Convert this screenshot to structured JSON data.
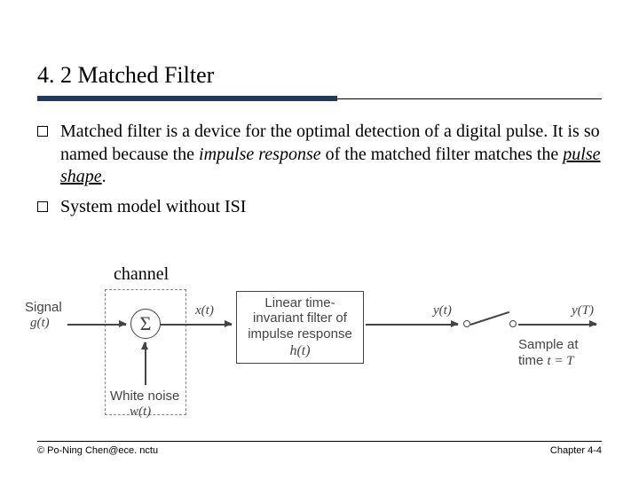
{
  "title": "4. 2 Matched Filter",
  "bullets": [
    {
      "pre": "Matched filter is a device for the optimal detection of a digital pulse. It is so named because the ",
      "em1": "impulse response",
      "mid": " of the matched filter matches the ",
      "em2": "pulse shape",
      "post": "."
    },
    {
      "text": "System model without ISI"
    }
  ],
  "channel_label": "channel",
  "diagram": {
    "signal_label": "Signal",
    "g_t": "g(t)",
    "sum": "Σ",
    "noise_label": "White noise",
    "w_t": "w(t)",
    "x_t": "x(t)",
    "filter_l1": "Linear time-",
    "filter_l2": "invariant filter of",
    "filter_l3": "impulse response",
    "h_t": "h(t)",
    "y_t": "y(t)",
    "y_T": "y(T)",
    "sample_l1": "Sample at",
    "sample_l2_pre": "time ",
    "sample_l2_var": "t = T"
  },
  "footer": {
    "left": "© Po-Ning Chen@ece. nctu",
    "right": "Chapter 4-4"
  }
}
